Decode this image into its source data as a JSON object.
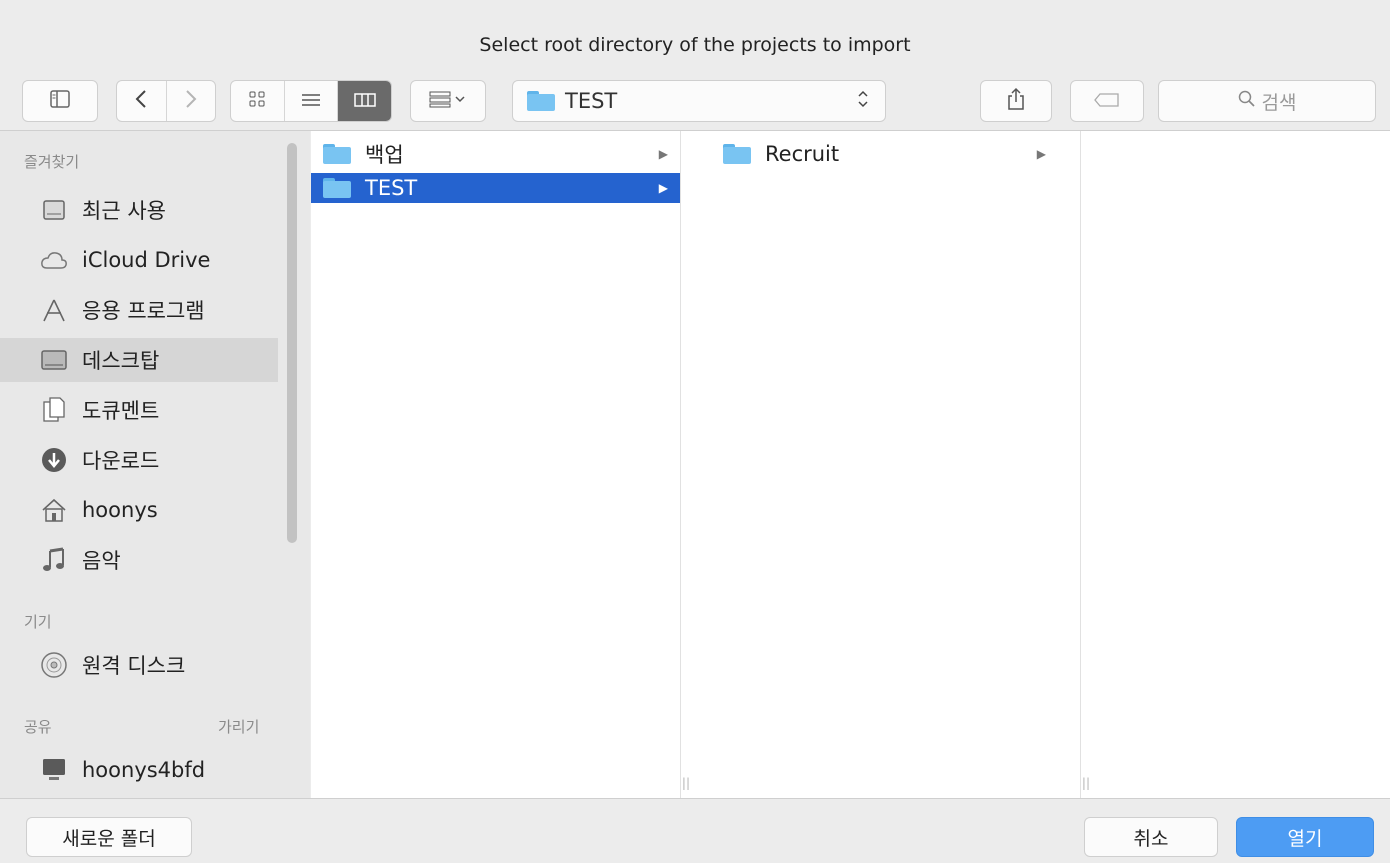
{
  "dialog": {
    "title": "Select root directory of the projects to import"
  },
  "toolbar": {
    "path_current": "TEST",
    "search_placeholder": "검색",
    "search_icon": "magnifier-icon",
    "sidebar_toggle_icon": "sidebar-toggle-icon",
    "back_icon": "chevron-left-icon",
    "forward_icon": "chevron-right-icon",
    "view_icons": [
      "icon-view-icon",
      "list-view-icon",
      "column-view-icon"
    ],
    "active_view": "column-view",
    "group_icon": "group-by-icon",
    "share_icon": "share-icon",
    "tag_icon": "tag-icon"
  },
  "sidebar": {
    "favorites_title": "즐겨찾기",
    "favorites": [
      {
        "label": "최근 사용",
        "icon": "recents-icon"
      },
      {
        "label": "iCloud Drive",
        "icon": "cloud-icon"
      },
      {
        "label": "응용 프로그램",
        "icon": "applications-icon"
      },
      {
        "label": "데스크탑",
        "icon": "desktop-icon",
        "selected": true
      },
      {
        "label": "도큐멘트",
        "icon": "documents-icon"
      },
      {
        "label": "다운로드",
        "icon": "downloads-icon"
      },
      {
        "label": "hoonys",
        "icon": "home-icon"
      },
      {
        "label": "음악",
        "icon": "music-icon"
      }
    ],
    "devices_title": "기기",
    "devices": [
      {
        "label": "원격 디스크",
        "icon": "disc-icon"
      }
    ],
    "shared_title": "공유",
    "shared_hide": "가리기",
    "shared": [
      {
        "label": "hoonys4bfd",
        "icon": "computer-icon"
      }
    ]
  },
  "columns": [
    {
      "rows": [
        {
          "label": "백업",
          "has_children": true,
          "selected": false
        },
        {
          "label": "TEST",
          "has_children": true,
          "selected": true
        }
      ]
    },
    {
      "rows": [
        {
          "label": "Recruit",
          "has_children": true,
          "selected": false
        }
      ]
    },
    {
      "rows": []
    }
  ],
  "footer": {
    "new_folder": "새로운 폴더",
    "cancel": "취소",
    "open": "열기"
  },
  "colors": {
    "selection": "#2563cf",
    "primary_button": "#4d9cf3",
    "folder": "#79c4f2"
  }
}
